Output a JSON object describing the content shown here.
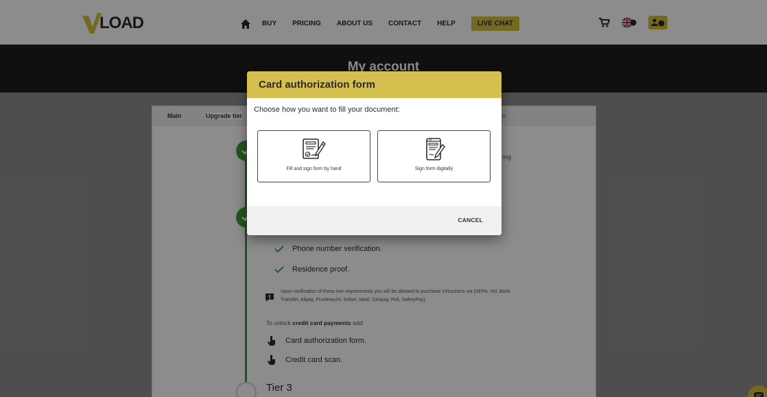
{
  "logo": {
    "text": "LOAD"
  },
  "nav": {
    "items": [
      "BUY",
      "PRICING",
      "ABOUT US",
      "CONTACT",
      "HELP"
    ],
    "live_chat": "LIVE CHAT"
  },
  "hero": {
    "title": "My account"
  },
  "tabs": [
    "Main",
    "Upgrade tier"
  ],
  "side_fragments": {
    "right_upper": "ing",
    "right_tab": "n"
  },
  "requirements": [
    "Phone number verification.",
    "Residence proof."
  ],
  "note": "Upon verification of these two requirements you will be allowed to purchase eVouchers via (SEPA, Intl. Bank Transfer, Alipay, Przelewy24, Sofort, Ideal, Giropay, Poli, SafetyPay).",
  "unlock": {
    "prefix": "To unlock ",
    "bold": "credit card payments",
    "suffix": " add:"
  },
  "unlock_items": [
    "Card authorization form.",
    "Credit card scan."
  ],
  "tier3": {
    "title": "Tier 3"
  },
  "modal": {
    "title": "Card authorization form",
    "prompt": "Choose how you want to fill your document:",
    "option_hand": "Fill and sign form by hand",
    "option_digital": "Sign form digitally",
    "cancel": "CANCEL"
  },
  "colors": {
    "accent": "#d5bf4f",
    "success": "#3f9d3f",
    "dark": "#1e1e1e"
  }
}
